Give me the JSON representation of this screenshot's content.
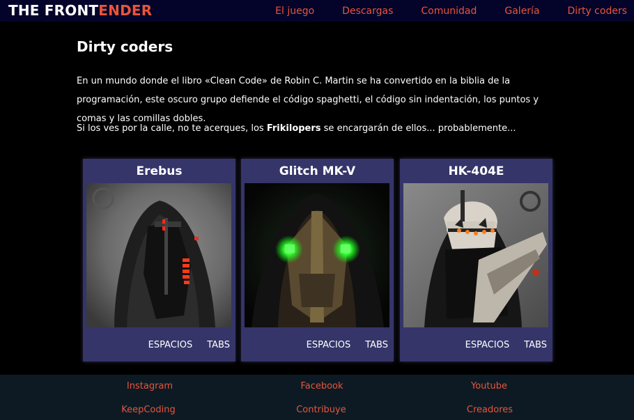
{
  "header": {
    "logo_part1": "THE FRONT",
    "logo_part2": "ENDER",
    "nav": [
      "El juego",
      "Descargas",
      "Comunidad",
      "Galería",
      "Dirty coders"
    ]
  },
  "main": {
    "title": "Dirty coders",
    "intro": "En un mundo donde el libro «Clean Code» de Robin C. Martin se ha convertido en la biblia de la programación, este oscuro grupo defiende el código spaghetti, el código sin indentación, los puntos y comas y las comillas dobles.",
    "warning_before": "Si los ves por la calle, no te acerques, los ",
    "warning_bold": "Frikilopers",
    "warning_after": " se encargarán de ellos... probablemente..."
  },
  "cards": [
    {
      "name": "Erebus",
      "image": "hooded-masked-figure-red-lights",
      "actions": [
        "ESPACIOS",
        "TABS"
      ]
    },
    {
      "name": "Glitch MK-V",
      "image": "hooded-masked-figure-green-eyes",
      "actions": [
        "ESPACIOS",
        "TABS"
      ]
    },
    {
      "name": "HK-404E",
      "image": "armored-soldier-with-rifle",
      "actions": [
        "ESPACIOS",
        "TABS"
      ]
    }
  ],
  "footer": {
    "links": [
      "Instagram",
      "Facebook",
      "Youtube",
      "KeepCoding",
      "Contribuye",
      "Creadores"
    ]
  },
  "colors": {
    "accent": "#e8553a",
    "topbar": "#04042a",
    "card": "#35356a",
    "footer": "#0d1a24"
  }
}
